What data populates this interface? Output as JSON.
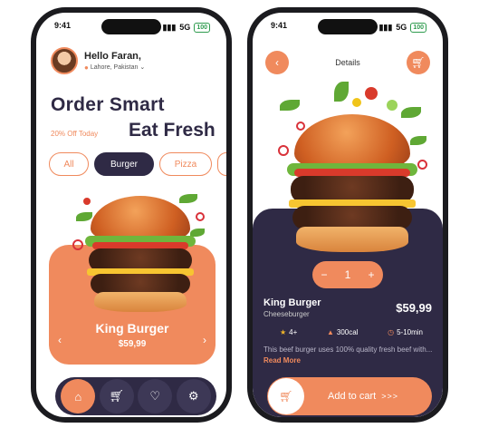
{
  "left_phone": {
    "status": {
      "time": "9:41",
      "signal": "5G",
      "battery": "100"
    },
    "greeting": "Hello Faran,",
    "location": "Lahore, Pakistan",
    "headline1": "Order Smart",
    "headline2": "Eat Fresh",
    "offer": "20% Off Today",
    "tabs": [
      "All",
      "Burger",
      "Pizza"
    ],
    "card": {
      "title": "King Burger",
      "price": "$59,99",
      "prev": "‹",
      "next": "›"
    }
  },
  "right_phone": {
    "status": {
      "time": "9:41",
      "signal": "5G",
      "battery": "100"
    },
    "title": "Details",
    "quantity": {
      "minus": "−",
      "value": "1",
      "plus": "+"
    },
    "name": "King Burger",
    "subtitle": "Cheeseburger",
    "price": "$59,99",
    "meta": {
      "rating": "4+",
      "calories": "300cal",
      "time": "5-10min"
    },
    "description": "This beef burger uses 100% quality fresh beef with...",
    "read_more": "Read More",
    "cart_label": "Add to cart",
    "cart_arrows": ">>>"
  },
  "colors": {
    "accent": "#f08a5d",
    "dark": "#2f2a45"
  },
  "icons": [
    "home-icon",
    "cart-icon",
    "heart-icon",
    "settings-icon",
    "back-icon",
    "star-icon",
    "fire-icon",
    "clock-icon",
    "location-pin-icon"
  ]
}
